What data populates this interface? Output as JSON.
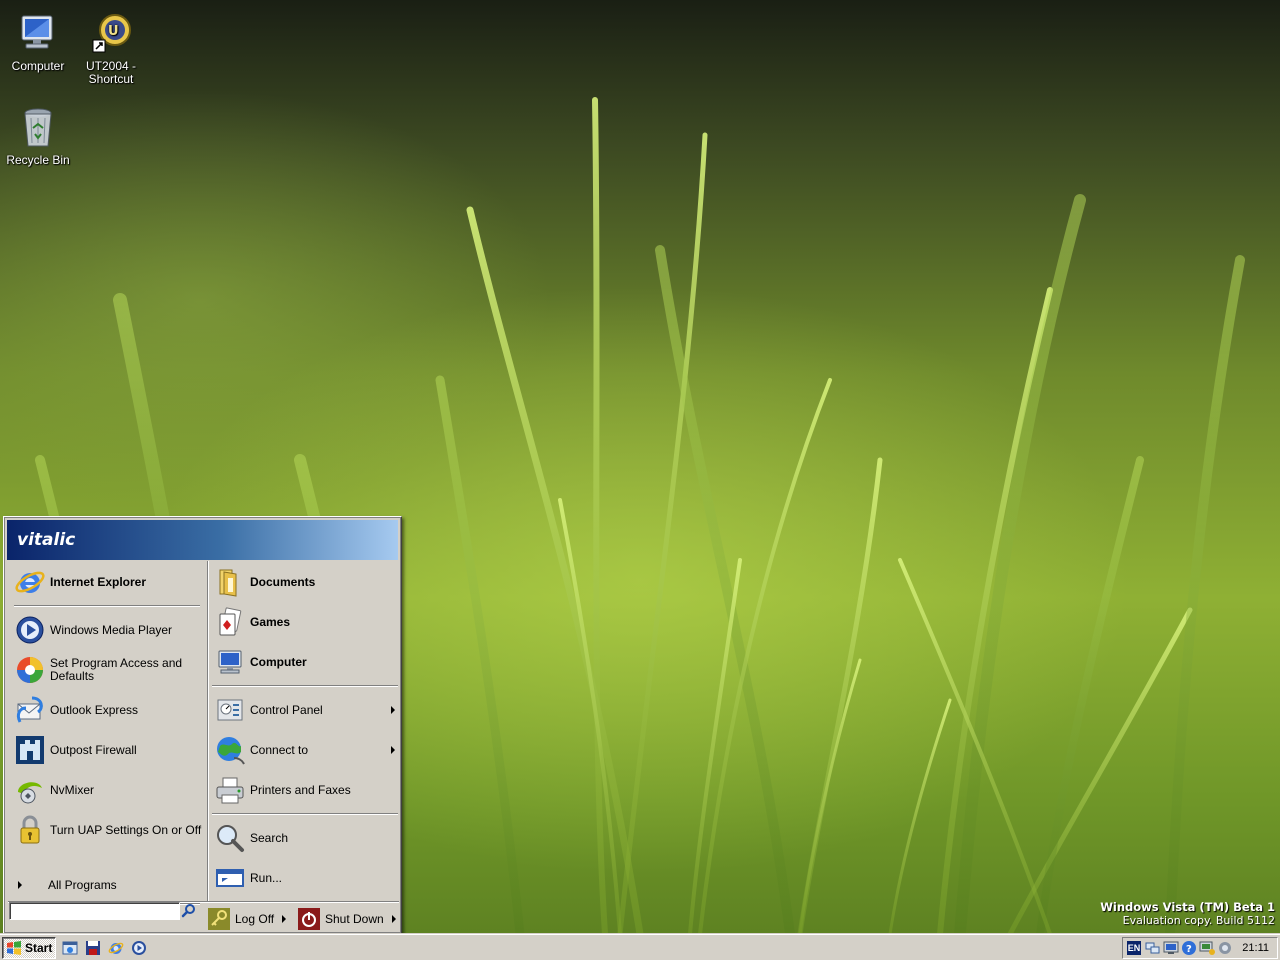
{
  "desktop": {
    "icons": [
      {
        "label": "Computer",
        "icon": "computer-icon"
      },
      {
        "label": "UT2004 - Shortcut",
        "icon": "ut2004-icon"
      },
      {
        "label": "Recycle Bin",
        "icon": "recycle-bin-icon"
      }
    ],
    "watermark": {
      "line1": "Windows Vista (TM) Beta 1",
      "line2": "Evaluation copy. Build 5112"
    }
  },
  "start_menu": {
    "user": "vitalic",
    "pinned": [
      {
        "label": "Internet Explorer",
        "icon": "internet-explorer-icon"
      }
    ],
    "recent": [
      {
        "label": "Windows Media Player",
        "icon": "media-player-icon"
      },
      {
        "label": "Set Program Access and Defaults",
        "icon": "program-access-icon"
      },
      {
        "label": "Outlook Express",
        "icon": "outlook-express-icon"
      },
      {
        "label": "Outpost Firewall",
        "icon": "outpost-firewall-icon"
      },
      {
        "label": "NvMixer",
        "icon": "nvmixer-icon"
      },
      {
        "label": "Turn UAP Settings On or Off",
        "icon": "lock-icon"
      }
    ],
    "all_programs": "All Programs",
    "places": [
      {
        "label": "Documents",
        "icon": "documents-icon"
      },
      {
        "label": "Games",
        "icon": "games-icon"
      },
      {
        "label": "Computer",
        "icon": "computer-icon"
      }
    ],
    "system": [
      {
        "label": "Control Panel",
        "icon": "control-panel-icon"
      },
      {
        "label": "Connect to",
        "icon": "connect-to-icon"
      },
      {
        "label": "Printers and Faxes",
        "icon": "printer-icon"
      }
    ],
    "tools": [
      {
        "label": "Search",
        "icon": "search-icon"
      },
      {
        "label": "Run...",
        "icon": "run-icon"
      }
    ],
    "search_value": "",
    "log_off": "Log Off",
    "shut_down": "Shut Down"
  },
  "taskbar": {
    "start_label": "Start",
    "quick_launch": [
      "explorer-icon",
      "save-icon",
      "internet-explorer-icon",
      "media-player-icon"
    ],
    "tray": {
      "language": "EN",
      "clock": "21:11"
    }
  },
  "colors": {
    "menu_face": "#d4d0c8",
    "header_dark": "#0a246a",
    "header_light": "#a6caf0"
  }
}
